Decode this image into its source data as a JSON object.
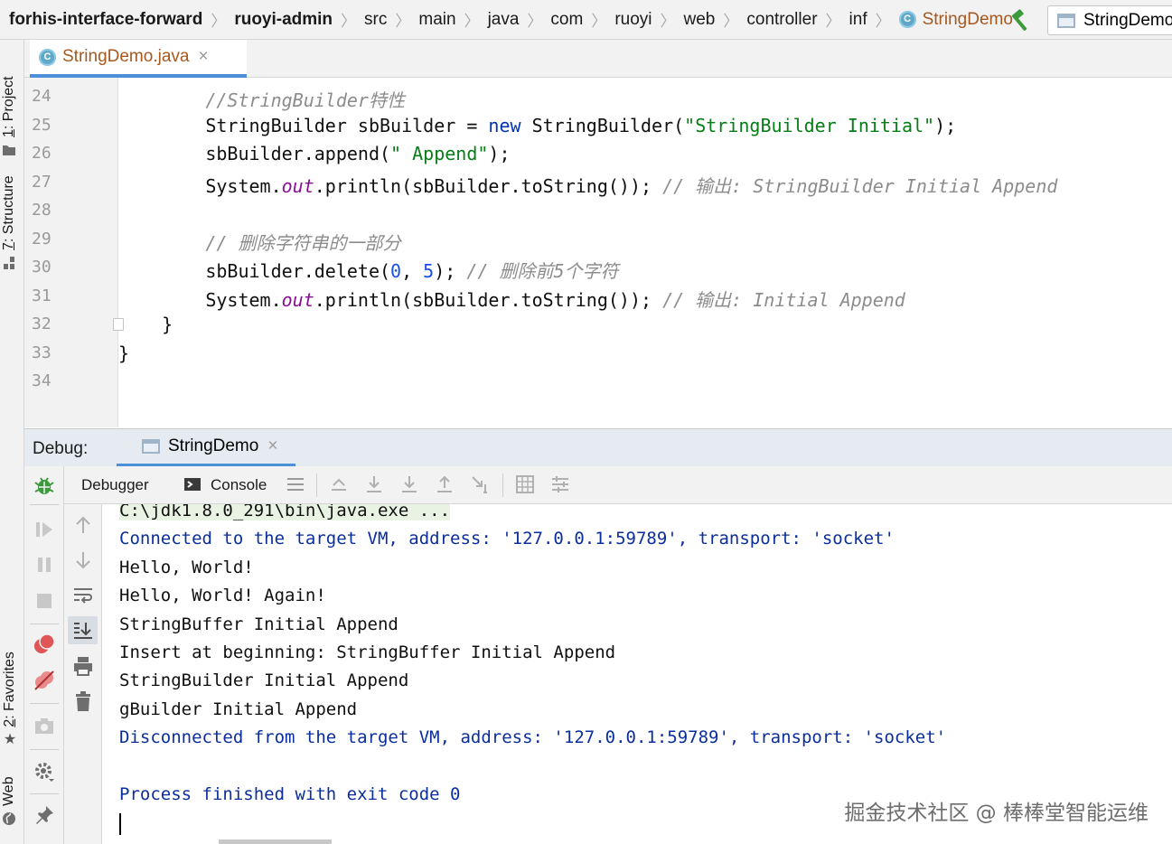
{
  "breadcrumb": {
    "items": [
      {
        "label": "forhis-interface-forward",
        "style": "bold"
      },
      {
        "label": "ruoyi-admin",
        "style": "bold"
      },
      {
        "label": "src",
        "style": "normal"
      },
      {
        "label": "main",
        "style": "normal"
      },
      {
        "label": "java",
        "style": "normal"
      },
      {
        "label": "com",
        "style": "normal"
      },
      {
        "label": "ruoyi",
        "style": "normal"
      },
      {
        "label": "web",
        "style": "normal"
      },
      {
        "label": "controller",
        "style": "normal"
      },
      {
        "label": "inf",
        "style": "normal"
      },
      {
        "label": "StringDemo",
        "style": "active",
        "icon": "class-icon"
      }
    ],
    "build_icon": "hammer-icon",
    "run_config_label": "StringDemo"
  },
  "left_stripe": {
    "project": {
      "num": "1",
      "label": ": Project"
    },
    "structure": {
      "num": "7",
      "label": ": Structure"
    },
    "favorites": {
      "num": "2",
      "label": ": Favorites"
    },
    "web": {
      "label": "Web"
    }
  },
  "editor_tab": {
    "label": "StringDemo.java",
    "close": "×",
    "badge": "C"
  },
  "editor": {
    "line_numbers": [
      "24",
      "25",
      "26",
      "27",
      "28",
      "29",
      "30",
      "31",
      "32",
      "33",
      "34"
    ],
    "lines": [
      [
        {
          "t": "        ",
          "c": ""
        },
        {
          "t": "//StringBuilder特性",
          "c": "cmt"
        }
      ],
      [
        {
          "t": "        StringBuilder sbBuilder = ",
          "c": ""
        },
        {
          "t": "new",
          "c": "kw"
        },
        {
          "t": " StringBuilder(",
          "c": ""
        },
        {
          "t": "\"StringBuilder Initial\"",
          "c": "str"
        },
        {
          "t": ");",
          "c": ""
        }
      ],
      [
        {
          "t": "        sbBuilder.append(",
          "c": ""
        },
        {
          "t": "\" Append\"",
          "c": "str"
        },
        {
          "t": ");",
          "c": ""
        }
      ],
      [
        {
          "t": "        System.",
          "c": ""
        },
        {
          "t": "out",
          "c": "field"
        },
        {
          "t": ".println(sbBuilder.toString()); ",
          "c": ""
        },
        {
          "t": "// 输出: StringBuilder Initial Append",
          "c": "cmt"
        }
      ],
      [
        {
          "t": "",
          "c": ""
        }
      ],
      [
        {
          "t": "        ",
          "c": ""
        },
        {
          "t": "// 删除字符串的一部分",
          "c": "cmt"
        }
      ],
      [
        {
          "t": "        sbBuilder.delete(",
          "c": ""
        },
        {
          "t": "0",
          "c": "num"
        },
        {
          "t": ", ",
          "c": ""
        },
        {
          "t": "5",
          "c": "num"
        },
        {
          "t": "); ",
          "c": ""
        },
        {
          "t": "// 删除前5个字符",
          "c": "cmt"
        }
      ],
      [
        {
          "t": "        System.",
          "c": ""
        },
        {
          "t": "out",
          "c": "field"
        },
        {
          "t": ".println(sbBuilder.toString()); ",
          "c": ""
        },
        {
          "t": "// 输出: Initial Append",
          "c": "cmt"
        }
      ],
      [
        {
          "t": "    }",
          "c": ""
        }
      ],
      [
        {
          "t": "}",
          "c": ""
        }
      ],
      [
        {
          "t": "",
          "c": ""
        }
      ]
    ]
  },
  "debug": {
    "title": "Debug:",
    "session_tab": "StringDemo",
    "session_close": "×",
    "tabs": {
      "debugger": "Debugger",
      "console": "Console"
    },
    "toolbar_icons": [
      "menu-icon",
      "show-execution-point-icon",
      "step-over-icon",
      "step-into-icon",
      "step-out-icon",
      "run-to-cursor-icon",
      "evaluate-icon",
      "trace-icon"
    ],
    "left_icons": [
      "bug-icon",
      "resume-icon",
      "pause-icon",
      "stop-icon",
      "view-breakpoints-icon",
      "mute-breakpoints-icon",
      "camera-icon",
      "settings-icon",
      "pin-icon"
    ],
    "right_icons": [
      "arrow-up-icon",
      "arrow-down-icon",
      "soft-wrap-icon",
      "scroll-to-end-icon",
      "print-icon",
      "clear-icon"
    ]
  },
  "console": {
    "lines": [
      {
        "text": "C:\\jdk1.8.0_291\\bin\\java.exe ...",
        "kind": "cmdline"
      },
      {
        "text": "Connected to the target VM, address: '127.0.0.1:59789', transport: 'socket'",
        "kind": "sys"
      },
      {
        "text": "Hello, World!",
        "kind": "out"
      },
      {
        "text": "Hello, World! Again!",
        "kind": "out"
      },
      {
        "text": "StringBuffer Initial Append",
        "kind": "out"
      },
      {
        "text": "Insert at beginning: StringBuffer Initial Append",
        "kind": "out"
      },
      {
        "text": "StringBuilder Initial Append",
        "kind": "out"
      },
      {
        "text": "gBuilder Initial Append",
        "kind": "out"
      },
      {
        "text": "Disconnected from the target VM, address: '127.0.0.1:59789', transport: 'socket'",
        "kind": "sys"
      },
      {
        "text": "",
        "kind": "out"
      },
      {
        "text": "Process finished with exit code 0",
        "kind": "sys"
      }
    ]
  },
  "watermark": "掘金技术社区 @ 棒棒堂智能运维",
  "colors": {
    "keyword": "#0033b3",
    "string": "#067d17",
    "number": "#1750eb",
    "field": "#871094",
    "comment": "#8c8c8c",
    "console_system": "#0b2e9e",
    "active_tab_underline": "#4a8fd8",
    "breadcrumb_active": "#a6581f"
  }
}
